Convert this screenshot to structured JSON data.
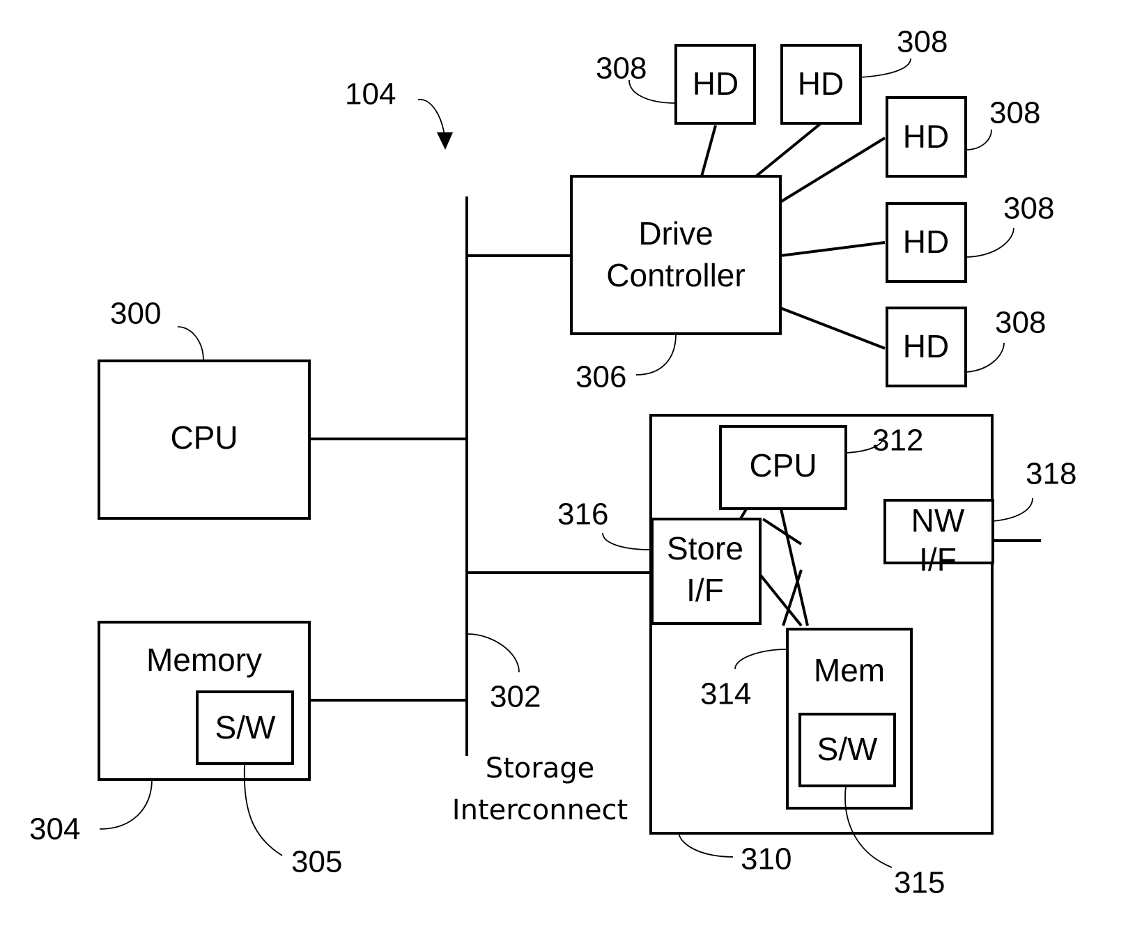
{
  "diagram": {
    "figure_ref": "104",
    "bus": {
      "ref": "302",
      "label_line1": "Storage",
      "label_line2": "Interconnect"
    },
    "cpu": {
      "label": "CPU",
      "ref": "300"
    },
    "memory": {
      "label": "Memory",
      "ref": "304",
      "software": {
        "label": "S/W",
        "ref": "305"
      }
    },
    "drive_controller": {
      "label_line1": "Drive",
      "label_line2": "Controller",
      "ref": "306"
    },
    "hard_drives": [
      {
        "label": "HD",
        "ref": "308"
      },
      {
        "label": "HD",
        "ref": "308"
      },
      {
        "label": "HD",
        "ref": "308"
      },
      {
        "label": "HD",
        "ref": "308"
      },
      {
        "label": "HD",
        "ref": "308"
      }
    ],
    "storage_processor": {
      "ref": "310",
      "cpu": {
        "label": "CPU",
        "ref": "312"
      },
      "store_if": {
        "label_line1": "Store",
        "label_line2": "I/F",
        "ref": "316"
      },
      "nw_if": {
        "label_line1": "NW",
        "label_line2": "I/F",
        "ref": "318"
      },
      "mem": {
        "label": "Mem",
        "ref": "314",
        "software": {
          "label": "S/W",
          "ref": "315"
        }
      }
    }
  }
}
